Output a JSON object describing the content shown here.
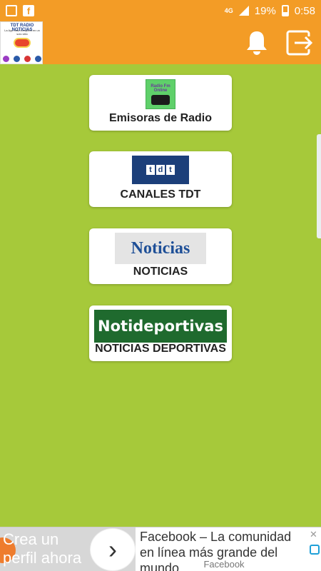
{
  "status_bar": {
    "network": "4G",
    "battery": "19%",
    "time": "0:58",
    "icons": [
      "square-app-icon",
      "facebook-icon",
      "signal-icon",
      "battery-icon"
    ]
  },
  "app_bar": {
    "logo_title": "TDT RADIO NOTICIAS",
    "logo_subtitle": "La App más completa en un solo sitio",
    "icons": [
      "bell-icon",
      "exit-icon"
    ],
    "color": "#f39c26"
  },
  "menu": {
    "items": [
      {
        "label": "Emisoras de Radio",
        "thumb_text": "Radio Fm Online",
        "icon": "radio-thumbnail"
      },
      {
        "label": "CANALES TDT",
        "thumb_text": "tdt",
        "icon": "tdt-thumbnail"
      },
      {
        "label": "NOTICIAS",
        "thumb_text": "Noticias",
        "icon": "noticias-thumbnail"
      },
      {
        "label": "NOTICIAS DEPORTIVAS",
        "thumb_text": "Notideportivas",
        "icon": "sports-thumbnail"
      }
    ]
  },
  "ad": {
    "left_text_line1": "Crea un",
    "left_text_line2": "perfil ahora",
    "title": "Facebook – La comunidad en línea más grande del mundo",
    "source": "Facebook",
    "close": "✕"
  },
  "colors": {
    "background": "#a6c93a",
    "accent": "#f39c26"
  }
}
